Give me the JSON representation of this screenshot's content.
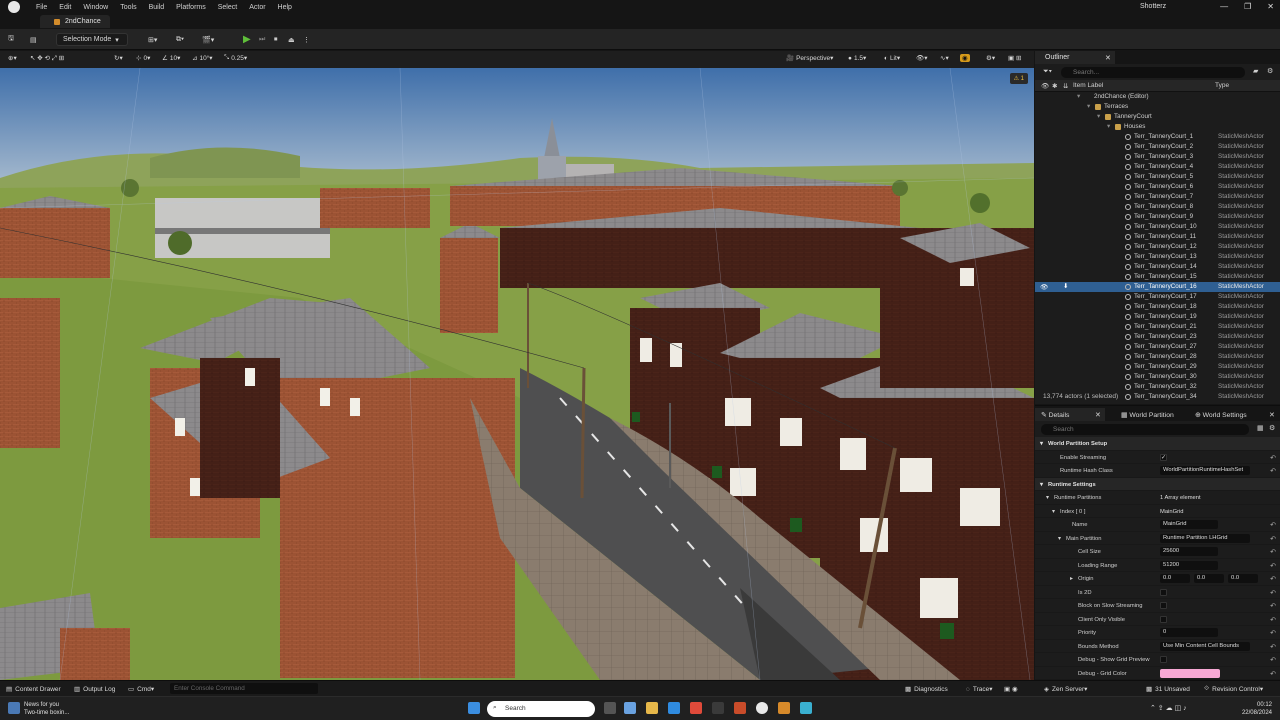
{
  "menubar": {
    "items": [
      "File",
      "Edit",
      "Window",
      "Tools",
      "Build",
      "Platforms",
      "Select",
      "Actor",
      "Help"
    ],
    "project_name": "Shotterz",
    "min": "—",
    "max": "❐",
    "close": "✕"
  },
  "tabbar": {
    "level_tab": "2ndChance"
  },
  "toolbar": {
    "mode_label": "Selection Mode"
  },
  "viewport_toolbar": {
    "translate_snap": "0",
    "rotate_snap": "10",
    "rotate_angle": "10°",
    "scale_snap": "0.25",
    "view_mode": "Perspective",
    "camera_speed": "1.5",
    "lighting": "Lit",
    "warning_count": "1"
  },
  "outliner": {
    "tab_label": "Outliner",
    "search_placeholder": "Search...",
    "col_label": "Item Label",
    "col_type": "Type",
    "tree": [
      {
        "label": "2ndChance (Editor)",
        "type": "",
        "indent": 0,
        "kind": "world"
      },
      {
        "label": "Terraces",
        "type": "",
        "indent": 1,
        "kind": "folder"
      },
      {
        "label": "TanneryCourt",
        "type": "",
        "indent": 2,
        "kind": "folder"
      },
      {
        "label": "Houses",
        "type": "",
        "indent": 3,
        "kind": "folder"
      },
      {
        "label": "Terr_TanneryCourt_1",
        "type": "StaticMeshActor",
        "indent": 4,
        "kind": "mesh"
      },
      {
        "label": "Terr_TanneryCourt_2",
        "type": "StaticMeshActor",
        "indent": 4,
        "kind": "mesh"
      },
      {
        "label": "Terr_TanneryCourt_3",
        "type": "StaticMeshActor",
        "indent": 4,
        "kind": "mesh"
      },
      {
        "label": "Terr_TanneryCourt_4",
        "type": "StaticMeshActor",
        "indent": 4,
        "kind": "mesh"
      },
      {
        "label": "Terr_TanneryCourt_5",
        "type": "StaticMeshActor",
        "indent": 4,
        "kind": "mesh"
      },
      {
        "label": "Terr_TanneryCourt_6",
        "type": "StaticMeshActor",
        "indent": 4,
        "kind": "mesh"
      },
      {
        "label": "Terr_TanneryCourt_7",
        "type": "StaticMeshActor",
        "indent": 4,
        "kind": "mesh"
      },
      {
        "label": "Terr_TanneryCourt_8",
        "type": "StaticMeshActor",
        "indent": 4,
        "kind": "mesh"
      },
      {
        "label": "Terr_TanneryCourt_9",
        "type": "StaticMeshActor",
        "indent": 4,
        "kind": "mesh"
      },
      {
        "label": "Terr_TanneryCourt_10",
        "type": "StaticMeshActor",
        "indent": 4,
        "kind": "mesh"
      },
      {
        "label": "Terr_TanneryCourt_11",
        "type": "StaticMeshActor",
        "indent": 4,
        "kind": "mesh"
      },
      {
        "label": "Terr_TanneryCourt_12",
        "type": "StaticMeshActor",
        "indent": 4,
        "kind": "mesh"
      },
      {
        "label": "Terr_TanneryCourt_13",
        "type": "StaticMeshActor",
        "indent": 4,
        "kind": "mesh"
      },
      {
        "label": "Terr_TanneryCourt_14",
        "type": "StaticMeshActor",
        "indent": 4,
        "kind": "mesh"
      },
      {
        "label": "Terr_TanneryCourt_15",
        "type": "StaticMeshActor",
        "indent": 4,
        "kind": "mesh"
      },
      {
        "label": "Terr_TanneryCourt_16",
        "type": "StaticMeshActor",
        "indent": 4,
        "kind": "mesh",
        "selected": true
      },
      {
        "label": "Terr_TanneryCourt_17",
        "type": "StaticMeshActor",
        "indent": 4,
        "kind": "mesh"
      },
      {
        "label": "Terr_TanneryCourt_18",
        "type": "StaticMeshActor",
        "indent": 4,
        "kind": "mesh"
      },
      {
        "label": "Terr_TanneryCourt_19",
        "type": "StaticMeshActor",
        "indent": 4,
        "kind": "mesh"
      },
      {
        "label": "Terr_TanneryCourt_21",
        "type": "StaticMeshActor",
        "indent": 4,
        "kind": "mesh"
      },
      {
        "label": "Terr_TanneryCourt_23",
        "type": "StaticMeshActor",
        "indent": 4,
        "kind": "mesh"
      },
      {
        "label": "Terr_TanneryCourt_27",
        "type": "StaticMeshActor",
        "indent": 4,
        "kind": "mesh"
      },
      {
        "label": "Terr_TanneryCourt_28",
        "type": "StaticMeshActor",
        "indent": 4,
        "kind": "mesh"
      },
      {
        "label": "Terr_TanneryCourt_29",
        "type": "StaticMeshActor",
        "indent": 4,
        "kind": "mesh"
      },
      {
        "label": "Terr_TanneryCourt_30",
        "type": "StaticMeshActor",
        "indent": 4,
        "kind": "mesh"
      },
      {
        "label": "Terr_TanneryCourt_32",
        "type": "StaticMeshActor",
        "indent": 4,
        "kind": "mesh"
      },
      {
        "label": "Terr_TanneryCourt_34",
        "type": "StaticMeshActor",
        "indent": 4,
        "kind": "mesh"
      }
    ],
    "actor_count": "13,774 actors (1 selected)"
  },
  "details": {
    "tabs": [
      "Details",
      "World Partition",
      "World Settings"
    ],
    "search_placeholder": "Search",
    "props": [
      {
        "name": "World Partition Setup",
        "kind": "cat",
        "indent": 0
      },
      {
        "name": "Enable Streaming",
        "kind": "check",
        "checked": true,
        "indent": 2
      },
      {
        "name": "Runtime Hash Class",
        "kind": "value",
        "value": "WorldPartitionRuntimeHashSet",
        "indent": 2
      },
      {
        "name": "Runtime Settings",
        "kind": "cat",
        "indent": 0
      },
      {
        "name": "Runtime Partitions",
        "kind": "plain",
        "value": "1 Array element",
        "indent": 1
      },
      {
        "name": "Index [ 0 ]",
        "kind": "plain",
        "value": "MainGrid",
        "indent": 2
      },
      {
        "name": "Name",
        "kind": "value",
        "value": "MainGrid",
        "indent": 4
      },
      {
        "name": "Main Partition",
        "kind": "value",
        "value": "Runtime Partition LHGrid",
        "indent": 3
      },
      {
        "name": "Cell Size",
        "kind": "value",
        "value": "25600",
        "indent": 5
      },
      {
        "name": "Loading Range",
        "kind": "value",
        "value": "51200",
        "indent": 5
      },
      {
        "name": "Origin",
        "kind": "triple",
        "values": [
          "0.0",
          "0.0",
          "0.0"
        ],
        "indent": 5
      },
      {
        "name": "Is 2D",
        "kind": "check",
        "checked": false,
        "indent": 5
      },
      {
        "name": "Block on Slow Streaming",
        "kind": "check",
        "checked": false,
        "indent": 5
      },
      {
        "name": "Client Only Visible",
        "kind": "check",
        "checked": false,
        "indent": 5
      },
      {
        "name": "Priority",
        "kind": "value",
        "value": "0",
        "indent": 5
      },
      {
        "name": "Bounds Method",
        "kind": "value",
        "value": "Use Min Content Cell Bounds",
        "indent": 5
      },
      {
        "name": "Debug - Show Grid Preview",
        "kind": "check",
        "checked": false,
        "indent": 5
      },
      {
        "name": "Debug - Grid Color",
        "kind": "color",
        "color": "#f7a8d4",
        "indent": 5
      }
    ]
  },
  "statusbar": {
    "content_drawer": "Content Drawer",
    "output_log": "Output Log",
    "cmd": "Cmd",
    "console_placeholder": "Enter Console Command",
    "diagnostics": "Diagnostics",
    "trace": "Trace",
    "zen_server": "Zen Server",
    "unsaved": "31 Unsaved",
    "revision_control": "Revision Control"
  },
  "taskbar": {
    "news_title": "News for you",
    "news_sub": "Two-time boxin...",
    "search_label": "Search",
    "time": "00:12",
    "date": "22/08/2024"
  },
  "colors": {
    "accent_selection": "#2f5f92",
    "play_green": "#5fbf3a",
    "folder": "#c9a04a",
    "grid_color": "#f7a8d4"
  }
}
